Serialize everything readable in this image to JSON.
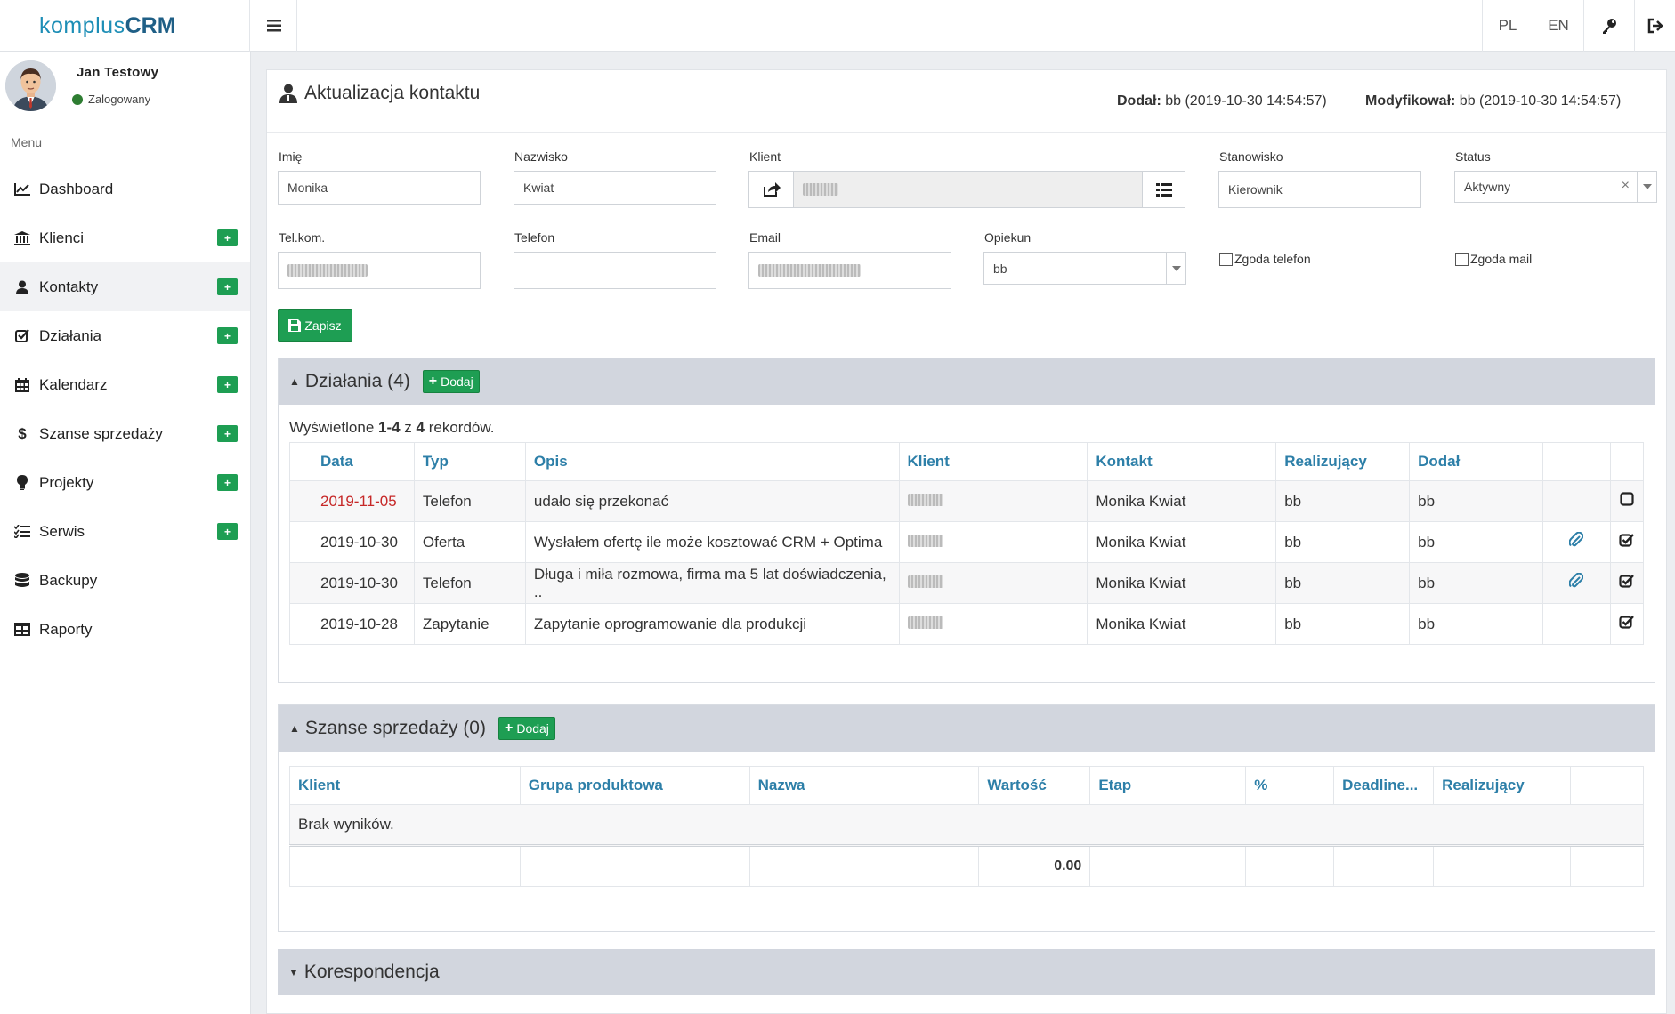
{
  "app": {
    "logo_part1": "komplus",
    "logo_part2": "CRM"
  },
  "topbar": {
    "lang_pl": "PL",
    "lang_en": "EN"
  },
  "user": {
    "name": "Jan Testowy",
    "status": "Zalogowany"
  },
  "sidebar": {
    "menu_label": "Menu",
    "items": [
      {
        "label": "Dashboard",
        "icon": "chart-line-icon",
        "add": false
      },
      {
        "label": "Klienci",
        "icon": "bank-icon",
        "add": true
      },
      {
        "label": "Kontakty",
        "icon": "user-icon",
        "add": true
      },
      {
        "label": "Działania",
        "icon": "check-square-icon",
        "add": true
      },
      {
        "label": "Kalendarz",
        "icon": "calendar-icon",
        "add": true
      },
      {
        "label": "Szanse sprzedaży",
        "icon": "dollar-icon",
        "add": true
      },
      {
        "label": "Projekty",
        "icon": "lightbulb-icon",
        "add": true
      },
      {
        "label": "Serwis",
        "icon": "list-check-icon",
        "add": true
      },
      {
        "label": "Backupy",
        "icon": "database-icon",
        "add": false
      },
      {
        "label": "Raporty",
        "icon": "table-icon",
        "add": false
      }
    ],
    "add_label": "+"
  },
  "page": {
    "title": "Aktualizacja kontaktu",
    "added_label": "Dodał:",
    "added_value": "bb (2019-10-30 14:54:57)",
    "modified_label": "Modyfikował:",
    "modified_value": "bb (2019-10-30 14:54:57)"
  },
  "form": {
    "imie_label": "Imię",
    "imie_value": "Monika",
    "nazwisko_label": "Nazwisko",
    "nazwisko_value": "Kwiat",
    "klient_label": "Klient",
    "stanowisko_label": "Stanowisko",
    "stanowisko_value": "Kierownik",
    "status_label": "Status",
    "status_value": "Aktywny",
    "telkom_label": "Tel.kom.",
    "telefon_label": "Telefon",
    "telefon_value": "",
    "email_label": "Email",
    "opiekun_label": "Opiekun",
    "opiekun_value": "bb",
    "zgoda_telefon": "Zgoda telefon",
    "zgoda_mail": "Zgoda mail",
    "save_label": "Zapisz"
  },
  "dzialania": {
    "title": "Działania (4)",
    "add_label": "Dodaj",
    "summary_prefix": "Wyświetlone ",
    "summary_range": "1-4",
    "summary_mid": " z ",
    "summary_total": "4",
    "summary_suffix": " rekordów.",
    "columns": [
      "Data",
      "Typ",
      "Opis",
      "Klient",
      "Kontakt",
      "Realizujący",
      "Dodał"
    ],
    "rows": [
      {
        "data": "2019-11-05",
        "typ": "Telefon",
        "opis": "udało się przekonać",
        "kontakt": "Monika Kwiat",
        "realizujacy": "bb",
        "dodal": "bb",
        "overdue": true,
        "attachment": false,
        "done": false
      },
      {
        "data": "2019-10-30",
        "typ": "Oferta",
        "opis": "Wysłałem ofertę ile może kosztować CRM + Optima",
        "kontakt": "Monika Kwiat",
        "realizujacy": "bb",
        "dodal": "bb",
        "overdue": false,
        "attachment": true,
        "done": true
      },
      {
        "data": "2019-10-30",
        "typ": "Telefon",
        "opis": "Długa i miła rozmowa, firma ma 5 lat doświadczenia, ..",
        "kontakt": "Monika Kwiat",
        "realizujacy": "bb",
        "dodal": "bb",
        "overdue": false,
        "attachment": true,
        "done": true
      },
      {
        "data": "2019-10-28",
        "typ": "Zapytanie",
        "opis": "Zapytanie oprogramowanie dla produkcji",
        "kontakt": "Monika Kwiat",
        "realizujacy": "bb",
        "dodal": "bb",
        "overdue": false,
        "attachment": false,
        "done": true
      }
    ]
  },
  "szanse": {
    "title": "Szanse sprzedaży (0)",
    "add_label": "Dodaj",
    "columns": [
      "Klient",
      "Grupa produktowa",
      "Nazwa",
      "Wartość",
      "Etap",
      "%",
      "Deadline...",
      "Realizujący"
    ],
    "empty": "Brak wyników.",
    "total": "0.00"
  },
  "korespondencja": {
    "title": "Korespondencja"
  },
  "colors": {
    "accent": "#2d7fa8",
    "green": "#1e9e53",
    "overdue": "#c62828",
    "section_header": "#d2d6de"
  }
}
